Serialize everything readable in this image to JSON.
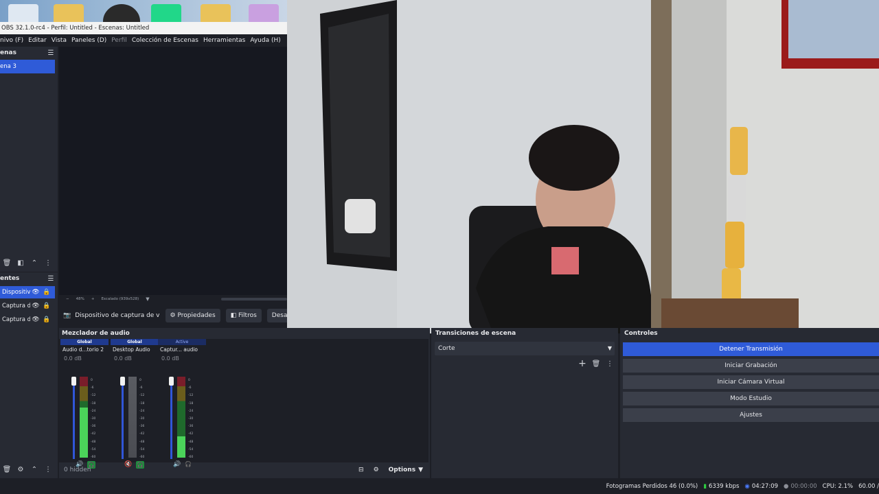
{
  "window": {
    "title": "OBS 32.1.0-rc4 - Perfil: Untitled - Escenas: Untitled"
  },
  "menu": [
    "nivo (F)",
    "Editar",
    "Vista",
    "Paneles (D)",
    "Perfil",
    "Colección de Escenas",
    "Herramientas",
    "Ayuda (H)"
  ],
  "scenes": {
    "title": "enas",
    "items": [
      "ena 3"
    ]
  },
  "sources": {
    "title": "entes",
    "items": [
      "Dispositiv",
      "Captura d",
      "Captura d"
    ]
  },
  "preview": {
    "zoom": "48%",
    "scaling": "Escalado (939x528)"
  },
  "source_toolbar": {
    "label": "Dispositivo de captura de v",
    "properties": "Propiedades",
    "filters": "Filtros",
    "deactivate": "Desactiv"
  },
  "mixer": {
    "title": "Mezclador de audio",
    "channels": [
      {
        "tag": "Global",
        "name": "Audio d...torio 2",
        "db": "0.0 dB",
        "level": 0.62
      },
      {
        "tag": "Global",
        "name": "Desktop Audio",
        "db": "0.0 dB",
        "level": 0.0
      },
      {
        "tag": "Active",
        "name": "Captur... audio",
        "db": "0.0 dB",
        "level": 0.26
      }
    ],
    "scale": [
      "0",
      "-6",
      "-12",
      "-18",
      "-24",
      "-30",
      "-36",
      "-42",
      "-48",
      "-54",
      "-60"
    ],
    "hidden_label": "0 hidden",
    "options_label": "Options"
  },
  "transitions": {
    "title": "Transiciones de escena",
    "selected": "Corte"
  },
  "controls": {
    "title": "Controles",
    "buttons": [
      "Detener Transmisión",
      "Iniciar Grabación",
      "Iniciar Cámara Virtual",
      "Modo Estudio",
      "Ajustes"
    ]
  },
  "status": {
    "dropped_frames": "Fotogramas Perdidos 46 (0.0%)",
    "bitrate": "6339 kbps",
    "stream_time": "04:27:09",
    "record_time": "00:00:00",
    "cpu": "CPU: 2.1%",
    "fps": "60.00 /"
  },
  "colors": {
    "accent": "#2f5bd8",
    "panel": "#272a33",
    "background": "#1d1f26"
  }
}
